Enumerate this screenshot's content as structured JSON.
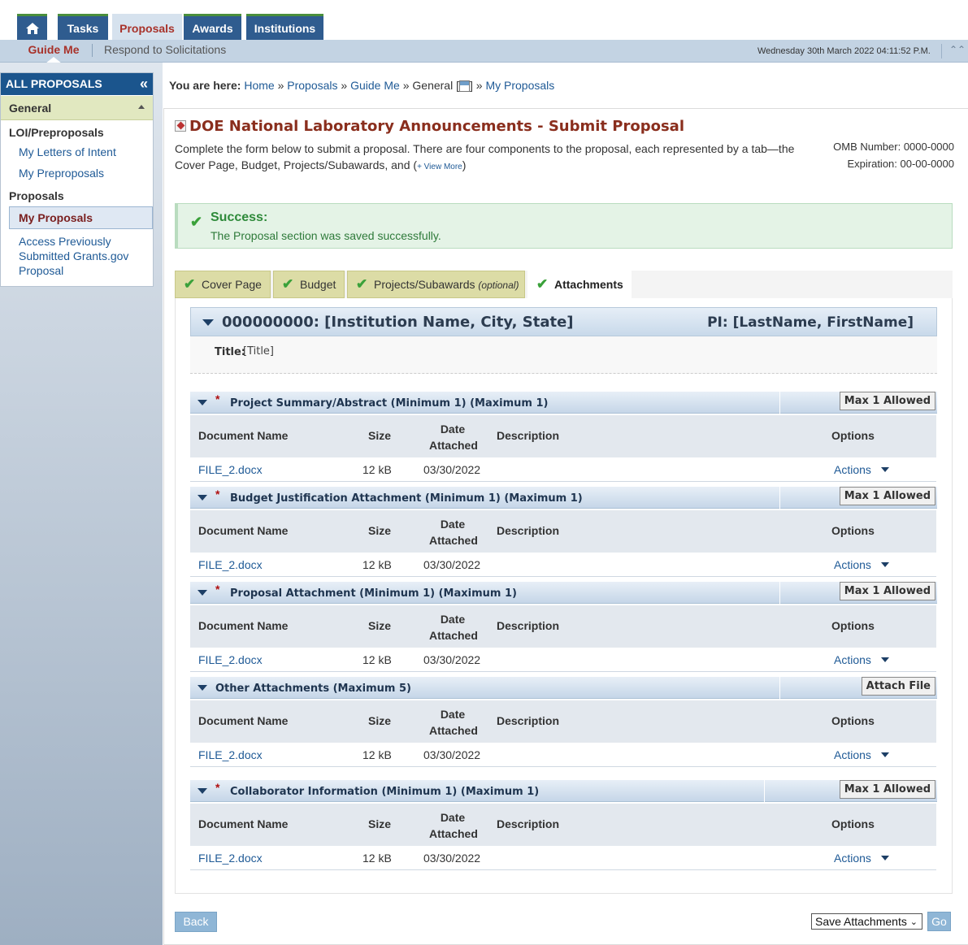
{
  "topnav": {
    "tabs": [
      {
        "label": "Tasks"
      },
      {
        "label": "Proposals"
      },
      {
        "label": "Awards"
      },
      {
        "label": "Institutions"
      }
    ]
  },
  "subnav": {
    "guide": "Guide Me",
    "respond": "Respond to Solicitations",
    "datetime": "Wednesday 30th March 2022 04:11:52 P.M."
  },
  "sidebar": {
    "header": "ALL PROPOSALS",
    "group": "General",
    "sections": [
      {
        "title": "LOI/Preproposals",
        "items": [
          "My Letters of Intent",
          "My Preproposals"
        ]
      },
      {
        "title": "Proposals",
        "items": [
          "My Proposals",
          "Access Previously Submitted Grants.gov Proposal"
        ]
      }
    ]
  },
  "breadcrumb": {
    "prefix": "You are here:",
    "home": "Home",
    "proposals": "Proposals",
    "guide": "Guide Me",
    "general": "General [",
    "general_close": "]",
    "current": "My Proposals"
  },
  "page": {
    "title": "DOE National Laboratory Announcements - Submit Proposal",
    "intro": "Complete the form below to submit a proposal. There are four components to the proposal, each represented by a tab—the Cover Page, Budget, Projects/Subawards, and (",
    "view_more": "+ View More",
    "intro_end": ")",
    "omb_number": "OMB Number: 0000-0000",
    "expiration": "Expiration: 00-00-0000"
  },
  "success": {
    "title": "Success:",
    "message": "The Proposal section was saved successfully."
  },
  "proposal_tabs": [
    {
      "label": "Cover Page"
    },
    {
      "label": "Budget"
    },
    {
      "label": "Projects/Subawards",
      "note": "(optional)"
    },
    {
      "label": "Attachments"
    }
  ],
  "institution": {
    "name": "000000000: [Institution Name, City, State]",
    "pi": "PI: [LastName, FirstName]",
    "title_label": "Title:",
    "title_value": "[Title]"
  },
  "columns": {
    "doc": "Document Name",
    "size": "Size",
    "date_1": "Date",
    "date_2": "Attached",
    "desc": "Description",
    "opt": "Options"
  },
  "sections": [
    {
      "title": "Project Summary/Abstract (Minimum 1) (Maximum 1)",
      "button": "Max 1 Allowed",
      "file": "FILE_2.docx",
      "size": "12 kB",
      "date": "03/30/2022",
      "action": "Actions"
    },
    {
      "title": "Budget Justification Attachment (Minimum 1) (Maximum 1)",
      "button": "Max 1 Allowed",
      "file": "FILE_2.docx",
      "size": "12 kB",
      "date": "03/30/2022",
      "action": "Actions"
    },
    {
      "title": "Proposal Attachment (Minimum 1) (Maximum 1)",
      "button": "Max 1 Allowed",
      "file": "FILE_2.docx",
      "size": "12 kB",
      "date": "03/30/2022",
      "action": "Actions"
    },
    {
      "title": "Other Attachments (Maximum 5)",
      "button": "Attach File",
      "file": "FILE_2.docx",
      "size": "12 kB",
      "date": "03/30/2022",
      "action": "Actions"
    },
    {
      "title": "Collaborator Information (Minimum 1) (Maximum 1)",
      "button": "Max 1 Allowed",
      "file": "FILE_2.docx",
      "size": "12 kB",
      "date": "03/30/2022",
      "action": "Actions"
    }
  ],
  "footer": {
    "back": "Back",
    "select_value": "Save Attachments",
    "go": "Go"
  }
}
